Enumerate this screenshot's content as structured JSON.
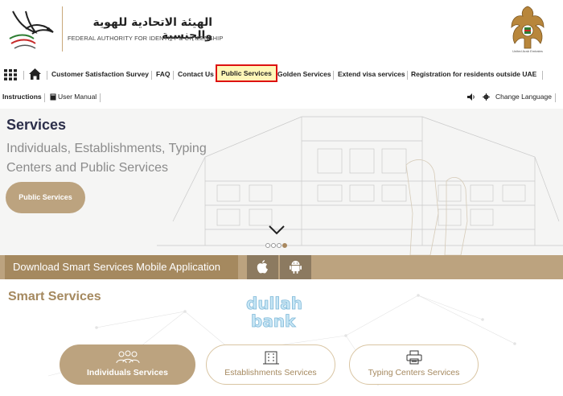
{
  "header": {
    "arabic_name": "الهيئة الاتحادية للهوية والجنسية",
    "english_name": "FEDERAL AUTHORITY FOR IDENTITY & CITIZENSHIP",
    "emblem_caption": "United Arab Emirates"
  },
  "nav_primary": {
    "items": [
      {
        "label": "Customer Satisfaction Survey"
      },
      {
        "label": "FAQ"
      },
      {
        "label": "Contact Us"
      },
      {
        "label": "Public Services",
        "active": true
      },
      {
        "label": "Golden Services"
      },
      {
        "label": "Extend visa services"
      },
      {
        "label": "Registration for residents outside UAE"
      }
    ],
    "icons": [
      "grid-menu-icon",
      "home-icon"
    ]
  },
  "nav_secondary": {
    "instructions": "Instructions",
    "user_manual": "User Manual",
    "change_language": "Change Language",
    "icons": [
      "book-icon",
      "speaker-icon",
      "gear-icon"
    ]
  },
  "hero": {
    "title": "Services",
    "subtitle": "Individuals, Establishments, Typing Centers and Public Services",
    "button_label": "Public Services",
    "slide_count": 4,
    "active_slide": 4
  },
  "download_bar": {
    "title": "Download Smart Services Mobile Application",
    "stores": [
      "apple-icon",
      "android-icon"
    ]
  },
  "smart_services": {
    "title": "Smart Services",
    "watermark_line1": "dullah",
    "watermark_line2": "bank",
    "buttons": [
      {
        "label": "Individuals Services",
        "icon": "people-icon",
        "selected": true
      },
      {
        "label": "Establishments Services",
        "icon": "building-icon",
        "selected": false
      },
      {
        "label": "Typing Centers Services",
        "icon": "printer-icon",
        "selected": false
      }
    ]
  },
  "colors": {
    "gold": "#bca37f",
    "gold_dark": "#a5895f",
    "navy": "#2c2f4a",
    "active_highlight": "#fff7b8",
    "active_border": "#dd1111"
  }
}
